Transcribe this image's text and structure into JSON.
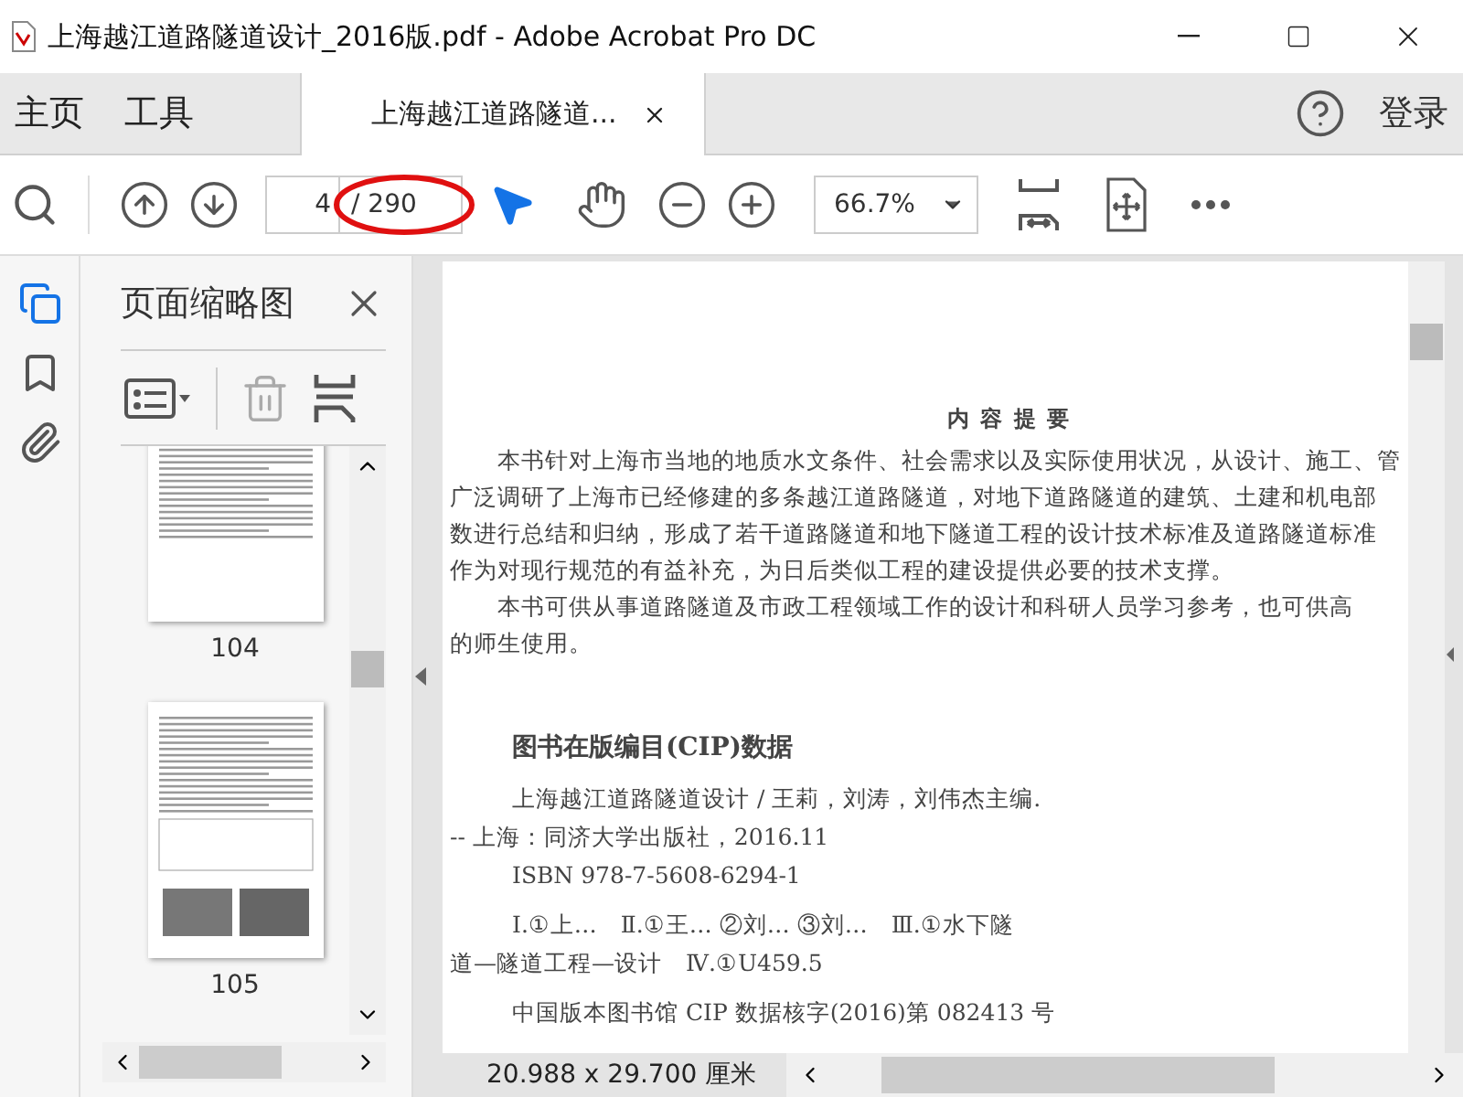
{
  "window": {
    "title": "上海越江道路隧道设计_2016版.pdf - Adobe Acrobat Pro DC"
  },
  "tabs": [
    {
      "label": "主页",
      "kind": "nav",
      "selected": false
    },
    {
      "label": "工具",
      "kind": "nav",
      "selected": false
    },
    {
      "label": "上海越江道路隧道...",
      "kind": "document",
      "selected": true
    }
  ],
  "sign_in": "登录",
  "toolbar": {
    "page_number": "4",
    "page_count": "/ 290",
    "zoom": "66.7%"
  },
  "side_rail": [
    {
      "kind": "pages",
      "selected": true
    },
    {
      "kind": "bookmarks",
      "selected": false
    },
    {
      "kind": "attachments",
      "selected": false
    }
  ],
  "panel": {
    "title": "页面缩略图",
    "thumbnails": [
      {
        "label": "104",
        "kind": "text"
      },
      {
        "label": "105",
        "kind": "photos"
      }
    ]
  },
  "document": {
    "heading": "内 容 提 要",
    "lines": [
      {
        "text": "本书针对上海市当地的地质水文条件、社会需求以及实际使用状况，从设计、施工、管",
        "kind": "indent"
      },
      {
        "text": "广泛调研了上海市已经修建的多条越江道路隧道，对地下道路隧道的建筑、土建和机电部",
        "kind": "flush"
      },
      {
        "text": "数进行总结和归纳，形成了若干道路隧道和地下隧道工程的设计技术标准及道路隧道标准",
        "kind": "flush"
      },
      {
        "text": "作为对现行规范的有益补充，为日后类似工程的建设提供必要的技术支撑。",
        "kind": "flush"
      },
      {
        "text": "本书可供从事道路隧道及市政工程领域工作的设计和科研人员学习参考，也可供高",
        "kind": "indent"
      },
      {
        "text": "的师生使用。",
        "kind": "flush"
      }
    ],
    "cip_title": "图书在版编目(CIP)数据",
    "cip_lines": [
      {
        "text": "上海越江道路隧道设计 / 王莉，刘涛，刘伟杰主编.",
        "kind": "indent"
      },
      {
        "text": "-- 上海：同济大学出版社，2016.11",
        "kind": "flush"
      },
      {
        "text": "ISBN 978-7-5608-6294-1",
        "kind": "indent"
      },
      {
        "text": "Ⅰ.①上…　Ⅱ.①王… ②刘… ③刘…　Ⅲ.①水下隧",
        "kind": "indent-gap"
      },
      {
        "text": "道—隧道工程—设计　Ⅳ.①U459.5",
        "kind": "flush"
      },
      {
        "text": "中国版本图书馆 CIP 数据核字(2016)第 082413 号",
        "kind": "indent-gap"
      }
    ]
  },
  "status_bar": {
    "page_size": "20.988 x 29.700 厘米"
  }
}
